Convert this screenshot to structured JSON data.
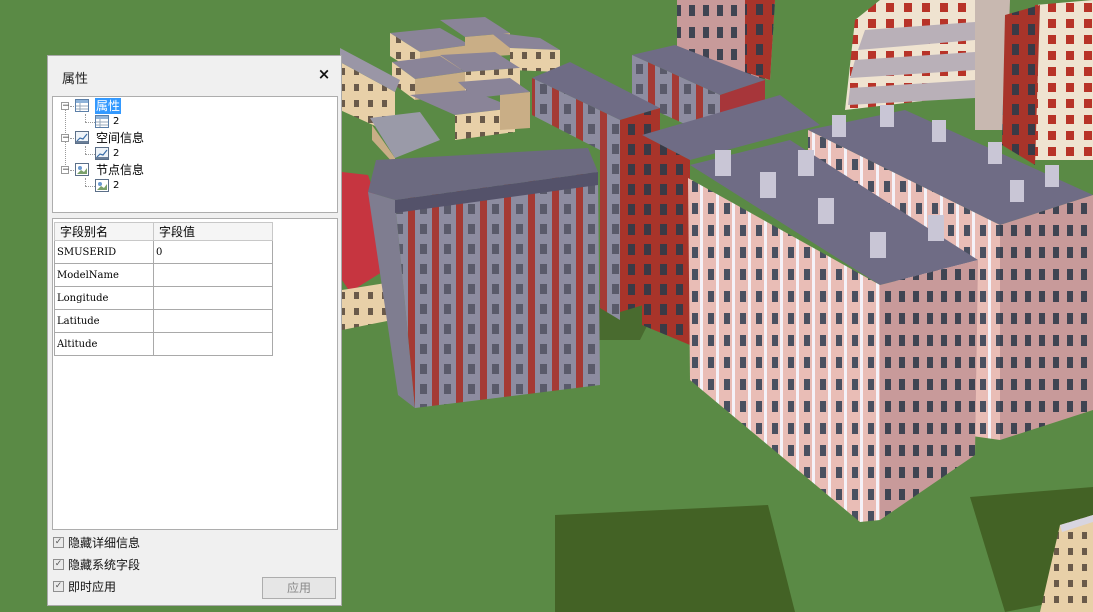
{
  "panel": {
    "title": "属性",
    "close_label": "×",
    "tree": [
      {
        "label": "属性",
        "child": "2",
        "selected": true
      },
      {
        "label": "空间信息",
        "child": "2",
        "selected": false
      },
      {
        "label": "节点信息",
        "child": "2",
        "selected": false
      }
    ],
    "table": {
      "headers": [
        "字段别名",
        "字段值"
      ],
      "rows": [
        {
          "name": "SMUSERID",
          "value": "0"
        },
        {
          "name": "ModelName",
          "value": ""
        },
        {
          "name": "Longitude",
          "value": ""
        },
        {
          "name": "Latitude",
          "value": ""
        },
        {
          "name": "Altitude",
          "value": ""
        }
      ]
    },
    "options": [
      {
        "label": "隐藏详细信息",
        "checked": true
      },
      {
        "label": "隐藏系统字段",
        "checked": true
      },
      {
        "label": "即时应用",
        "checked": true
      }
    ],
    "apply_label": "应用"
  },
  "colors": {
    "ground": "#5a8a45",
    "selection": "#3399ff",
    "roof": "#6f6c85",
    "brick": "#b0352b",
    "pink_wall": "#e6b8b2"
  }
}
